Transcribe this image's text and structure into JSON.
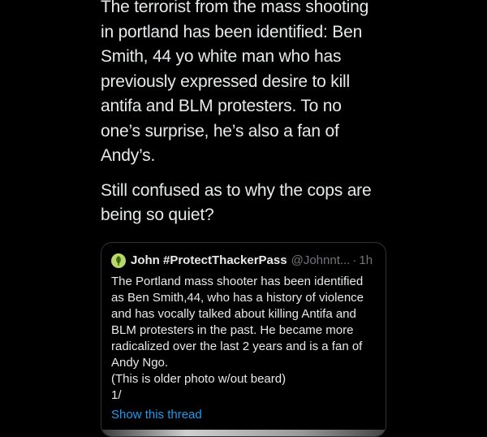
{
  "tweet": {
    "paragraphs": [
      {
        "lines": [
          "The terrorist from the mass shooting",
          "in portland has been identified: Ben",
          "Smith, 44 yo white man who has",
          "previously expressed desire to kill",
          "antifa and BLM protesters. To no",
          "one’s surprise, he’s also a fan of",
          "Andy’s."
        ]
      },
      {
        "lines": [
          "Still confused as to why the cops are",
          "being so quiet?"
        ]
      }
    ]
  },
  "quote": {
    "avatar_icon": "leaf-avatar-icon",
    "author_name": "John #ProtectThackerPass",
    "author_handle": "@Johnnt...",
    "separator": "·",
    "time": "1h",
    "lines": [
      "The Portland mass shooter has been identified",
      "as Ben Smith,44, who has a history of violence",
      "and has vocally talked about killing Antifa and",
      "BLM protesters in the past. He became more",
      "radicalized over the last 2 years and is a fan of",
      "Andy Ngo.",
      "(This is older photo w/out beard)",
      "1/"
    ],
    "show_thread_label": "Show this thread"
  },
  "colors": {
    "background": "#000000",
    "text": "#e7e9ea",
    "muted": "#71767b",
    "link": "#1d9bf0",
    "border": "#2f3336"
  }
}
